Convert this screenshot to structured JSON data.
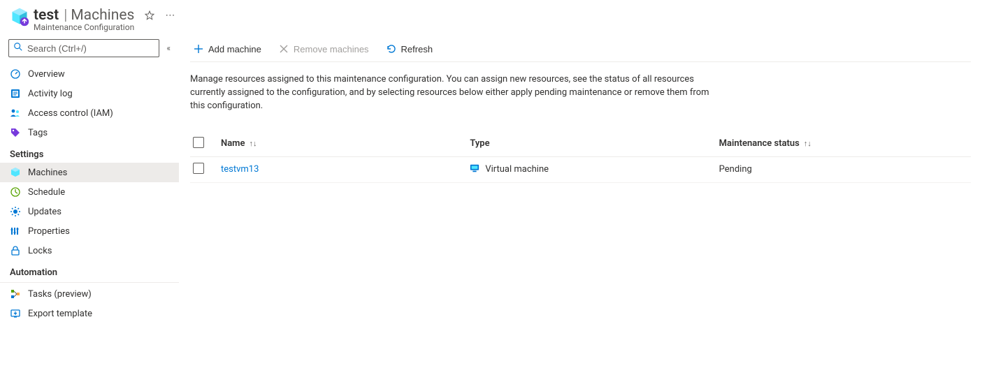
{
  "header": {
    "resource_name": "test",
    "separator": "|",
    "page_title": "Machines",
    "subtitle": "Maintenance Configuration"
  },
  "search": {
    "placeholder": "Search (Ctrl+/)"
  },
  "nav": {
    "top": [
      {
        "label": "Overview"
      },
      {
        "label": "Activity log"
      },
      {
        "label": "Access control (IAM)"
      },
      {
        "label": "Tags"
      }
    ],
    "section_settings": "Settings",
    "settings": [
      {
        "label": "Machines"
      },
      {
        "label": "Schedule"
      },
      {
        "label": "Updates"
      },
      {
        "label": "Properties"
      },
      {
        "label": "Locks"
      }
    ],
    "section_automation": "Automation",
    "automation": [
      {
        "label": "Tasks (preview)"
      },
      {
        "label": "Export template"
      }
    ]
  },
  "toolbar": {
    "add": "Add machine",
    "remove": "Remove machines",
    "refresh": "Refresh"
  },
  "description": "Manage resources assigned to this maintenance configuration. You can assign new resources, see the status of all resources currently assigned to the configuration, and by selecting resources below either apply pending maintenance or remove them from this configuration.",
  "table": {
    "col_name": "Name",
    "col_type": "Type",
    "col_status": "Maintenance status",
    "rows": [
      {
        "name": "testvm13",
        "type": "Virtual machine",
        "status": "Pending"
      }
    ]
  }
}
